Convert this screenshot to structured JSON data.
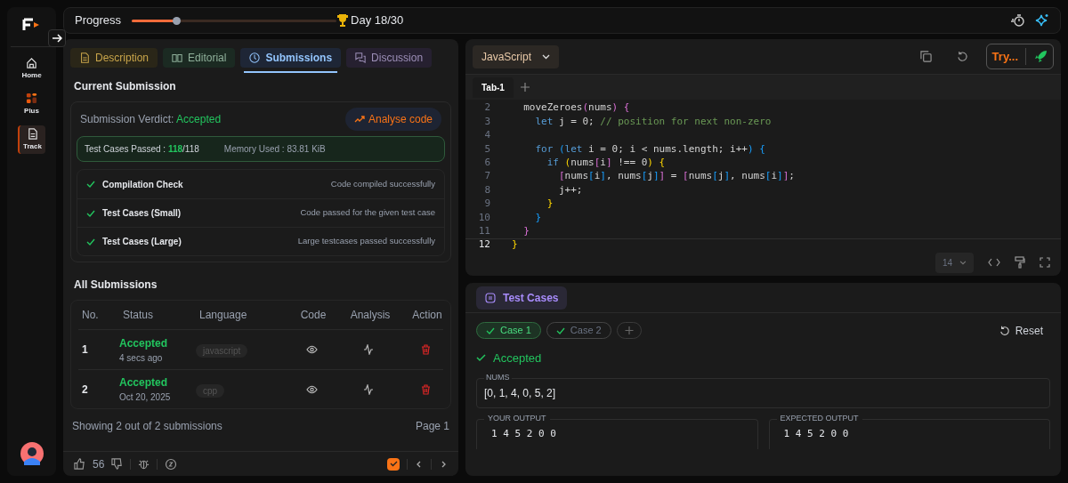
{
  "sidebar": {
    "items": [
      {
        "label": "Home",
        "selected": false
      },
      {
        "label": "Plus",
        "selected": false
      },
      {
        "label": "Track",
        "selected": true
      }
    ]
  },
  "top_bar": {
    "progress_label": "Progress",
    "progress": {
      "level": 0.22
    },
    "day": "Day 18/30"
  },
  "tabs": [
    {
      "label": "Description",
      "selected": false
    },
    {
      "label": "Editorial",
      "selected": false
    },
    {
      "label": "Submissions",
      "selected": true
    },
    {
      "label": "Discussion",
      "selected": false
    }
  ],
  "current_submission": {
    "title": "Current Submission",
    "verdict_label": "Submission Verdict:",
    "verdict": "Accepted",
    "analyse_button": "Analyse code",
    "passed_label": "Test Cases Passed :",
    "passed": "118",
    "total": "/118",
    "memory": "Memory Used : 83.81 KiB",
    "checks": [
      {
        "name": "Compilation Check",
        "detail": "Code compiled successfully",
        "passed": true
      },
      {
        "name": "Test Cases (Small)",
        "detail": "Code passed for the given test case",
        "passed": true
      },
      {
        "name": "Test Cases (Large)",
        "detail": "Large testcases passed successfully",
        "passed": true
      }
    ]
  },
  "all_submissions": {
    "title": "All Submissions",
    "columns": [
      "No.",
      "Status",
      "Language",
      "Code",
      "Analysis",
      "Action"
    ],
    "rows": [
      {
        "no": "1",
        "status": "Accepted",
        "time": "4 secs ago",
        "language": "javascript"
      },
      {
        "no": "2",
        "status": "Accepted",
        "time": "Oct 20, 2025",
        "language": "cpp"
      }
    ],
    "footer": "Showing 2 out of 2 submissions",
    "page": "Page 1"
  },
  "bottom_bar": {
    "likes": "56",
    "checked": true
  },
  "editor": {
    "language": "JavaScript",
    "run_button": "Try...",
    "tabs": [
      {
        "label": "Tab-1",
        "selected": true
      }
    ],
    "lines": [
      {
        "number": "2",
        "tokens": [
          {
            "text": "  moveZeroes",
            "kind": "plain"
          },
          {
            "text": "(",
            "kind": "b2"
          },
          {
            "text": "nums",
            "kind": "plain"
          },
          {
            "text": ")",
            "kind": "b2"
          },
          {
            "text": " {",
            "kind": "b2"
          }
        ]
      },
      {
        "number": "3",
        "tokens": [
          {
            "text": "    let",
            "kind": "keyword"
          },
          {
            "text": " j = 0; ",
            "kind": "plain"
          },
          {
            "text": "// position for next non-zero",
            "kind": "comment"
          }
        ]
      },
      {
        "number": "4"
      },
      {
        "number": "5",
        "tokens": [
          {
            "text": "    for",
            "kind": "keyword"
          },
          {
            "text": " (",
            "kind": "b3"
          },
          {
            "text": "let",
            "kind": "keyword"
          },
          {
            "text": " i = 0; i < nums.length; i++",
            "kind": "plain"
          },
          {
            "text": ")",
            "kind": "b3"
          },
          {
            "text": " {",
            "kind": "b3"
          }
        ]
      },
      {
        "number": "6",
        "tokens": [
          {
            "text": "      if",
            "kind": "keyword"
          },
          {
            "text": " (",
            "kind": "b1"
          },
          {
            "text": "nums",
            "kind": "plain"
          },
          {
            "text": "[",
            "kind": "b2"
          },
          {
            "text": "i",
            "kind": "plain"
          },
          {
            "text": "]",
            "kind": "b2"
          },
          {
            "text": " !== 0",
            "kind": "plain"
          },
          {
            "text": ")",
            "kind": "b1"
          },
          {
            "text": " {",
            "kind": "b1"
          }
        ]
      },
      {
        "number": "7",
        "tokens": [
          {
            "text": "        [",
            "kind": "b2"
          },
          {
            "text": "nums",
            "kind": "plain"
          },
          {
            "text": "[",
            "kind": "b3"
          },
          {
            "text": "i",
            "kind": "plain"
          },
          {
            "text": "]",
            "kind": "b3"
          },
          {
            "text": ", nums",
            "kind": "plain"
          },
          {
            "text": "[",
            "kind": "b3"
          },
          {
            "text": "j",
            "kind": "plain"
          },
          {
            "text": "]",
            "kind": "b3"
          },
          {
            "text": "]",
            "kind": "b2"
          },
          {
            "text": " = ",
            "kind": "plain"
          },
          {
            "text": "[",
            "kind": "b2"
          },
          {
            "text": "nums",
            "kind": "plain"
          },
          {
            "text": "[",
            "kind": "b3"
          },
          {
            "text": "j",
            "kind": "plain"
          },
          {
            "text": "]",
            "kind": "b3"
          },
          {
            "text": ", nums",
            "kind": "plain"
          },
          {
            "text": "[",
            "kind": "b3"
          },
          {
            "text": "i",
            "kind": "plain"
          },
          {
            "text": "]",
            "kind": "b3"
          },
          {
            "text": "]",
            "kind": "b2"
          },
          {
            "text": ";",
            "kind": "plain"
          }
        ]
      },
      {
        "number": "8",
        "tokens": [
          {
            "text": "        j++;",
            "kind": "plain"
          }
        ]
      },
      {
        "number": "9",
        "tokens": [
          {
            "text": "      }",
            "kind": "b1"
          }
        ]
      },
      {
        "number": "10",
        "tokens": [
          {
            "text": "    }",
            "kind": "b3"
          }
        ]
      },
      {
        "number": "11",
        "tokens": [
          {
            "text": "  }",
            "kind": "b2"
          }
        ]
      },
      {
        "number": "12",
        "tokens": [
          {
            "text": "}",
            "kind": "b1"
          }
        ]
      }
    ],
    "font_size": "14"
  },
  "test_panel": {
    "title": "Test Cases",
    "cases": [
      {
        "label": "Case 1",
        "selected": true
      },
      {
        "label": "Case 2",
        "selected": false
      }
    ],
    "reset": "Reset",
    "result": "Accepted",
    "input_label": "NUMS",
    "input_value": "[0, 1, 4, 0, 5, 2]",
    "your_output_label": "YOUR OUTPUT",
    "your_output": "1 4 5 2 0 0",
    "expected_label": "EXPECTED OUTPUT",
    "expected": "1 4 5 2 0 0"
  }
}
